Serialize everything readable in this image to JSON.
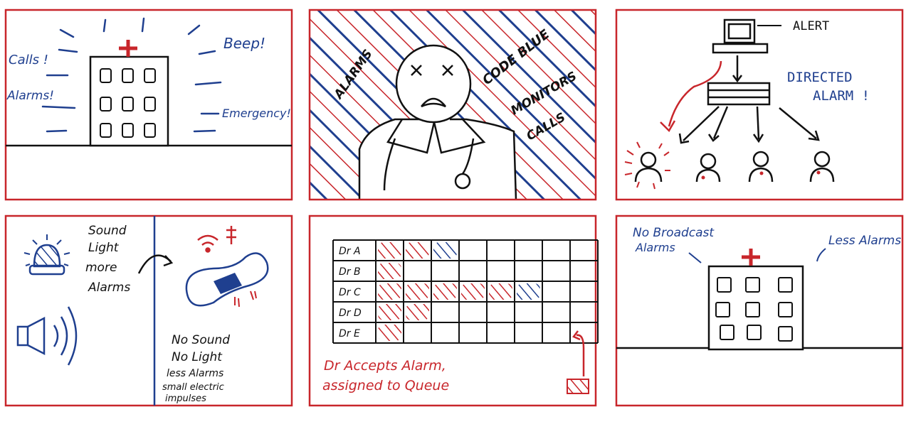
{
  "colors": {
    "ink": "#111111",
    "red": "#c8262b",
    "blue": "#1f3f8f",
    "frame": "#c8262b"
  },
  "panel1": {
    "calls": "Calls !",
    "alarms": "Alarms!",
    "beep": "Beep!",
    "emergency": "Emergency!"
  },
  "panel2": {
    "alarms": "ALARMS",
    "code_blue": "CODE BLUE",
    "monitors": "MONITORS",
    "calls": "CALLS"
  },
  "panel3": {
    "alert": "ALERT",
    "directed_1": "DIRECTED",
    "directed_2": "ALARM !"
  },
  "panel4": {
    "top_1": "Sound",
    "top_2": "Light",
    "top_3": "more",
    "top_4": "Alarms",
    "bottom_1": "No Sound",
    "bottom_2": "No Light",
    "bottom_3": "less Alarms",
    "bottom_4": "small electric",
    "bottom_5": "impulses"
  },
  "panel5": {
    "rows": [
      "Dr A",
      "Dr B",
      "Dr C",
      "Dr D",
      "Dr E"
    ],
    "note_1": "Dr Accepts Alarm,",
    "note_2": "assigned to Queue"
  },
  "panel6": {
    "no_broadcast_1": "No Broadcast",
    "no_broadcast_2": "Alarms",
    "less_alarms": "Less Alarms"
  }
}
